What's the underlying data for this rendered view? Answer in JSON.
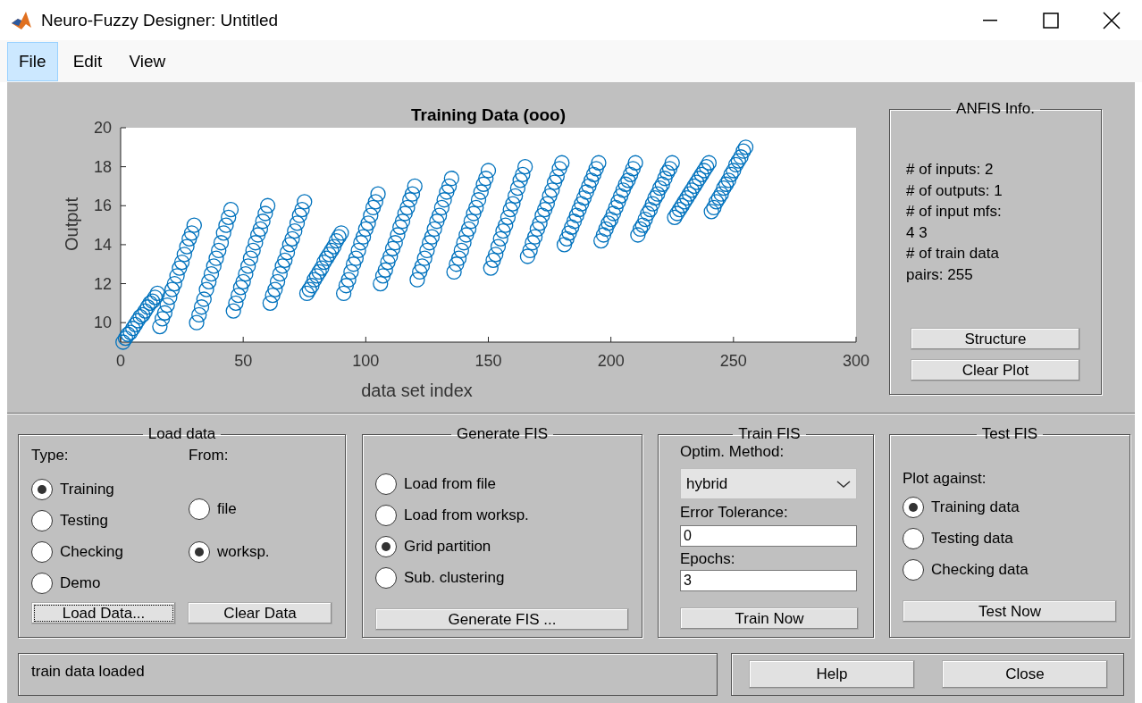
{
  "window": {
    "title": "Neuro-Fuzzy Designer: Untitled"
  },
  "menu": [
    {
      "label": "File",
      "selected": true
    },
    {
      "label": "Edit",
      "selected": false
    },
    {
      "label": "View",
      "selected": false
    }
  ],
  "plot": {
    "chart_data": {
      "type": "scatter",
      "title": "Training Data (ooo)",
      "xlabel": "data set index",
      "ylabel": "Output",
      "xlim": [
        0,
        300
      ],
      "ylim": [
        9,
        20
      ],
      "xticks": [
        0,
        50,
        100,
        150,
        200,
        250,
        300
      ],
      "yticks": [
        10,
        12,
        14,
        16,
        18,
        20
      ],
      "x": [
        1,
        2,
        3,
        4,
        5,
        6,
        7,
        8,
        9,
        10,
        11,
        12,
        13,
        14,
        15,
        16,
        17,
        18,
        19,
        20,
        21,
        22,
        23,
        24,
        25,
        26,
        27,
        28,
        29,
        30,
        31,
        32,
        33,
        34,
        35,
        36,
        37,
        38,
        39,
        40,
        41,
        42,
        43,
        44,
        45,
        46,
        47,
        48,
        49,
        50,
        51,
        52,
        53,
        54,
        55,
        56,
        57,
        58,
        59,
        60,
        61,
        62,
        63,
        64,
        65,
        66,
        67,
        68,
        69,
        70,
        71,
        72,
        73,
        74,
        75,
        76,
        77,
        78,
        79,
        80,
        81,
        82,
        83,
        84,
        85,
        86,
        87,
        88,
        89,
        90,
        91,
        92,
        93,
        94,
        95,
        96,
        97,
        98,
        99,
        100,
        101,
        102,
        103,
        104,
        105,
        106,
        107,
        108,
        109,
        110,
        111,
        112,
        113,
        114,
        115,
        116,
        117,
        118,
        119,
        120,
        121,
        122,
        123,
        124,
        125,
        126,
        127,
        128,
        129,
        130,
        131,
        132,
        133,
        134,
        135,
        136,
        137,
        138,
        139,
        140,
        141,
        142,
        143,
        144,
        145,
        146,
        147,
        148,
        149,
        150,
        151,
        152,
        153,
        154,
        155,
        156,
        157,
        158,
        159,
        160,
        161,
        162,
        163,
        164,
        165,
        166,
        167,
        168,
        169,
        170,
        171,
        172,
        173,
        174,
        175,
        176,
        177,
        178,
        179,
        180,
        181,
        182,
        183,
        184,
        185,
        186,
        187,
        188,
        189,
        190,
        191,
        192,
        193,
        194,
        195,
        196,
        197,
        198,
        199,
        200,
        201,
        202,
        203,
        204,
        205,
        206,
        207,
        208,
        209,
        210,
        211,
        212,
        213,
        214,
        215,
        216,
        217,
        218,
        219,
        220,
        221,
        222,
        223,
        224,
        225,
        226,
        227,
        228,
        229,
        230,
        231,
        232,
        233,
        234,
        235,
        236,
        237,
        238,
        239,
        240,
        241,
        242,
        243,
        244,
        245,
        246,
        247,
        248,
        249,
        250,
        251,
        252,
        253,
        254,
        255
      ],
      "series": [
        {
          "color": "#0072bd",
          "values": [
            9.0,
            9.2,
            9.4,
            9.5,
            9.7,
            9.9,
            10.1,
            10.3,
            10.4,
            10.6,
            10.8,
            11.0,
            11.1,
            11.3,
            11.5,
            9.8,
            10.2,
            10.5,
            10.9,
            11.3,
            11.7,
            12.0,
            12.4,
            12.8,
            13.1,
            13.5,
            13.9,
            14.3,
            14.6,
            15.0,
            10.0,
            10.4,
            10.8,
            11.2,
            11.7,
            12.1,
            12.5,
            12.9,
            13.3,
            13.7,
            14.1,
            14.6,
            15.0,
            15.4,
            15.8,
            10.6,
            11.0,
            11.4,
            11.8,
            12.1,
            12.5,
            12.9,
            13.3,
            13.7,
            14.1,
            14.5,
            14.8,
            15.2,
            15.6,
            16.0,
            11.0,
            11.4,
            11.7,
            12.1,
            12.5,
            12.9,
            13.2,
            13.6,
            14.0,
            14.3,
            14.7,
            15.1,
            15.5,
            15.8,
            16.2,
            11.5,
            11.7,
            11.9,
            12.2,
            12.4,
            12.6,
            12.8,
            13.1,
            13.3,
            13.5,
            13.7,
            13.9,
            14.2,
            14.4,
            14.6,
            11.5,
            11.9,
            12.2,
            12.6,
            13.0,
            13.3,
            13.7,
            14.1,
            14.4,
            14.8,
            15.1,
            15.5,
            15.9,
            16.2,
            16.6,
            12.0,
            12.4,
            12.7,
            13.1,
            13.4,
            13.8,
            14.1,
            14.5,
            14.9,
            15.2,
            15.6,
            15.9,
            16.3,
            16.6,
            17.0,
            12.2,
            12.6,
            12.9,
            13.3,
            13.7,
            14.1,
            14.4,
            14.8,
            15.2,
            15.5,
            15.9,
            16.3,
            16.7,
            17.0,
            17.4,
            12.6,
            13.0,
            13.3,
            13.7,
            14.1,
            14.5,
            14.8,
            15.2,
            15.6,
            15.9,
            16.3,
            16.7,
            17.1,
            17.4,
            17.8,
            12.8,
            13.2,
            13.5,
            13.9,
            14.3,
            14.7,
            15.0,
            15.4,
            15.8,
            16.1,
            16.5,
            16.9,
            17.3,
            17.6,
            18.0,
            13.4,
            13.7,
            14.1,
            14.4,
            14.8,
            15.1,
            15.5,
            15.8,
            16.1,
            16.5,
            16.8,
            17.2,
            17.5,
            17.9,
            18.2,
            14.0,
            14.3,
            14.6,
            14.9,
            15.2,
            15.5,
            15.8,
            16.1,
            16.4,
            16.7,
            17.0,
            17.3,
            17.6,
            17.9,
            18.2,
            14.2,
            14.5,
            14.8,
            15.1,
            15.3,
            15.6,
            15.9,
            16.2,
            16.5,
            16.8,
            17.1,
            17.3,
            17.6,
            17.9,
            18.2,
            14.5,
            14.8,
            15.0,
            15.3,
            15.6,
            15.8,
            16.1,
            16.4,
            16.6,
            16.9,
            17.1,
            17.4,
            17.7,
            17.9,
            18.2,
            15.4,
            15.6,
            15.8,
            16.0,
            16.2,
            16.4,
            16.6,
            16.8,
            17.0,
            17.2,
            17.4,
            17.6,
            17.8,
            18.0,
            18.2,
            15.7,
            15.9,
            16.2,
            16.4,
            16.6,
            16.9,
            17.1,
            17.3,
            17.6,
            17.8,
            18.1,
            18.3,
            18.5,
            18.8,
            19.0
          ]
        }
      ]
    }
  },
  "anfis_info": {
    "title": "ANFIS Info.",
    "lines": [
      "# of inputs: 2",
      "# of outputs: 1",
      "# of input mfs:",
      "4  3",
      "# of train data",
      "pairs: 255"
    ],
    "buttons": [
      "Structure",
      "Clear Plot"
    ]
  },
  "load_data": {
    "title": "Load data",
    "type_label": "Type:",
    "from_label": "From:",
    "type_options": [
      {
        "label": "Training",
        "selected": true
      },
      {
        "label": "Testing",
        "selected": false
      },
      {
        "label": "Checking",
        "selected": false
      },
      {
        "label": "Demo",
        "selected": false
      }
    ],
    "from_options": [
      {
        "label": "file",
        "selected": false
      },
      {
        "label": "worksp.",
        "selected": true
      }
    ],
    "buttons": [
      {
        "label": "Load Data...",
        "focused": true
      },
      {
        "label": "Clear Data",
        "focused": false
      }
    ]
  },
  "generate_fis": {
    "title": "Generate FIS",
    "options": [
      {
        "label": "Load from file",
        "selected": false
      },
      {
        "label": "Load from worksp.",
        "selected": false
      },
      {
        "label": "Grid partition",
        "selected": true
      },
      {
        "label": "Sub. clustering",
        "selected": false
      }
    ],
    "button": "Generate FIS ..."
  },
  "train_fis": {
    "title": "Train FIS",
    "method_label": "Optim. Method:",
    "method_value": "hybrid",
    "tolerance_label": "Error Tolerance:",
    "tolerance_value": "0",
    "epochs_label": "Epochs:",
    "epochs_value": "3",
    "button": "Train Now"
  },
  "test_fis": {
    "title": "Test FIS",
    "plot_label": "Plot against:",
    "options": [
      {
        "label": "Training data",
        "selected": true
      },
      {
        "label": "Testing data",
        "selected": false
      },
      {
        "label": "Checking data",
        "selected": false
      }
    ],
    "button": "Test Now"
  },
  "status": {
    "text": "train data loaded"
  },
  "footer_buttons": [
    "Help",
    "Close"
  ]
}
